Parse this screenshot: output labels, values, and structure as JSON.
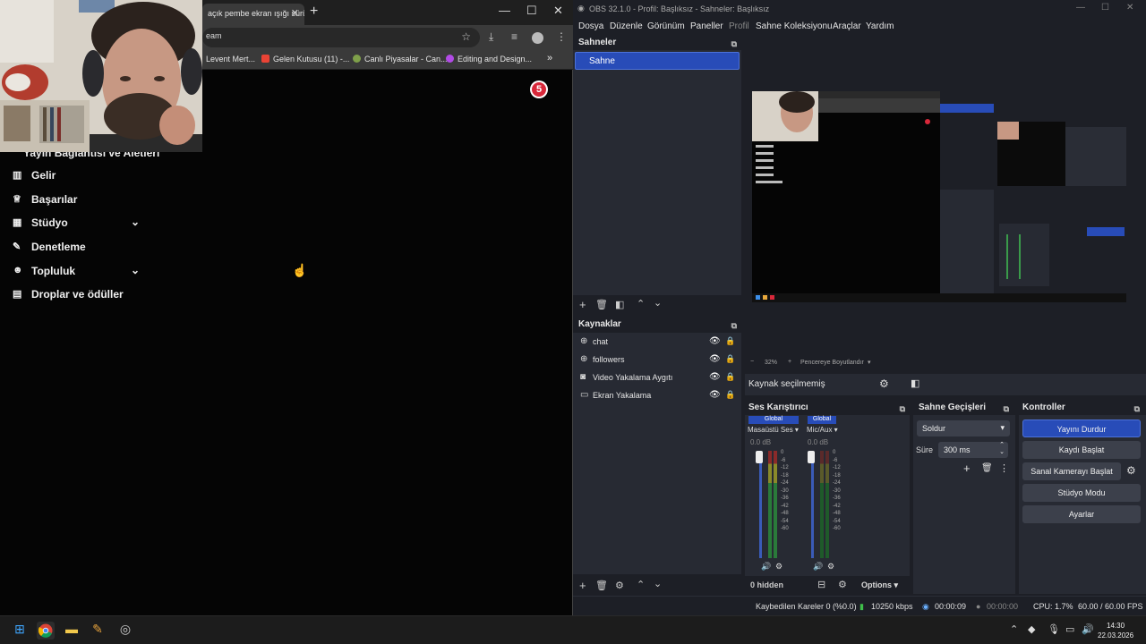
{
  "chrome": {
    "tab_title": "açık pembe ekran ışığı sürü",
    "address": "eam",
    "bookmarks": [
      "Levent Mert...",
      "Gelen Kutusu (11) -...",
      "Canlı Piyasalar - Can...",
      "Editing and Design..."
    ],
    "notification_count": "5",
    "menu_heading": "Yayın Bağlantısı ve Aletleri",
    "sidebar": [
      {
        "label": "Gelir",
        "icon": "revenue-icon",
        "expandable": false
      },
      {
        "label": "Başarılar",
        "icon": "trophy-icon",
        "expandable": false
      },
      {
        "label": "Stüdyo",
        "icon": "studio-icon",
        "expandable": true
      },
      {
        "label": "Denetleme",
        "icon": "wrench-icon",
        "expandable": false
      },
      {
        "label": "Topluluk",
        "icon": "community-icon",
        "expandable": true
      },
      {
        "label": "Droplar ve ödüller",
        "icon": "gift-icon",
        "expandable": false
      }
    ]
  },
  "obs": {
    "title": "OBS 32.1.0 - Profil: Başlıksız - Sahneler: Başlıksız",
    "menu": [
      "Dosya",
      "Düzenle",
      "Görünüm",
      "Paneller",
      "Profil",
      "Sahne Koleksiyonu",
      "Araçlar",
      "Yardım"
    ],
    "scenes_title": "Sahneler",
    "scenes": [
      "Sahne"
    ],
    "sources_title": "Kaynaklar",
    "sources": [
      {
        "label": "chat",
        "icon": "browser-source-icon"
      },
      {
        "label": "followers",
        "icon": "browser-source-icon"
      },
      {
        "label": "Video Yakalama Aygıtı",
        "icon": "camera-icon"
      },
      {
        "label": "Ekran Yakalama",
        "icon": "monitor-icon"
      }
    ],
    "zoom": "32%",
    "fit_label": "Pencereye Boyutlandır",
    "no_source": "Kaynak seçilmemiş",
    "mixer_title": "Ses Karıştırıcı",
    "mixer_channels": [
      {
        "scope": "Global",
        "name": "Masaüstü Ses",
        "db": "0.0 dB"
      },
      {
        "scope": "Global",
        "name": "Mic/Aux",
        "db": "0.0 dB"
      }
    ],
    "meter_ticks": [
      "0",
      "-6",
      "-12",
      "-18",
      "-24",
      "-30",
      "-36",
      "-42",
      "-48",
      "-54",
      "-60"
    ],
    "hidden_label": "0 hidden",
    "options_label": "Options",
    "transitions_title": "Sahne Geçişleri",
    "transition": "Soldur",
    "duration_label": "Süre",
    "duration_value": "300 ms",
    "controls_title": "Kontroller",
    "controls": [
      "Yayını Durdur",
      "Kaydı Başlat",
      "Sanal Kamerayı Başlat",
      "Stüdyo Modu",
      "Ayarlar"
    ],
    "status": {
      "dropped": "Kaybedilen Kareler 0 (%0.0)",
      "bitrate": "10250 kbps",
      "stream_time": "00:00:09",
      "record_time": "00:00:00",
      "cpu": "CPU: 1.7%",
      "fps": "60.00 / 60.00 FPS"
    }
  },
  "taskbar": {
    "time": "14:30",
    "date": "22.03.2026"
  },
  "colors": {
    "obs_accent": "#284cb8",
    "obs_bg": "#1d1f26",
    "obs_panel": "#272a33",
    "badge_red": "#d9283a"
  }
}
